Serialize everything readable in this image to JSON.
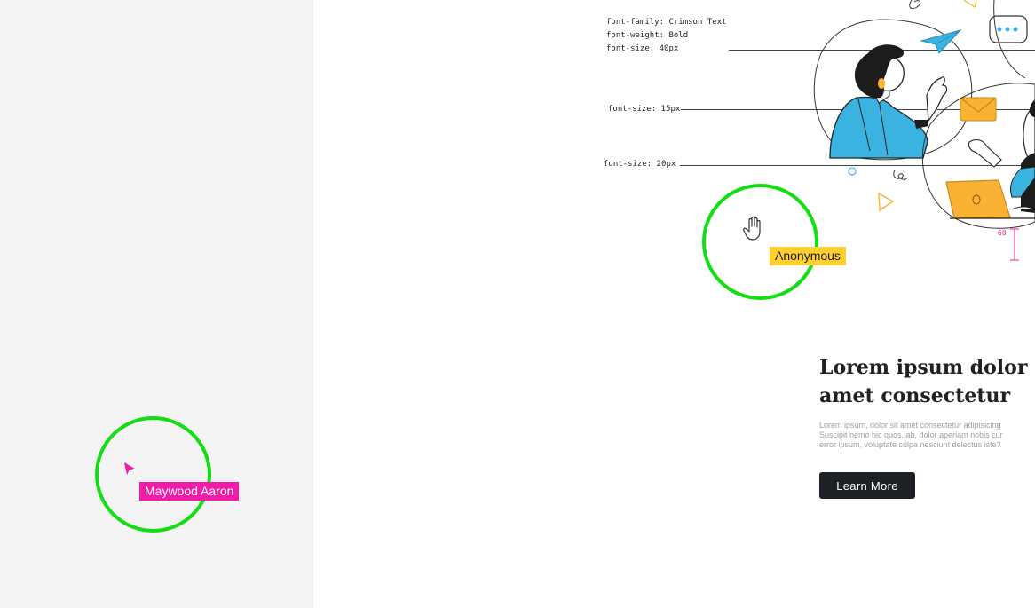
{
  "specs": {
    "font_family": "font-family: Crimson Text",
    "font_weight": "font-weight: Bold",
    "font_size_40": "font-size: 40px",
    "font_size_15": "font-size: 15px",
    "font_size_20": "font-size: 20px"
  },
  "measurement": "60",
  "content": {
    "heading": "Lorem ipsum dolor sit\namet consectetur",
    "body": "Lorem ipsum, dolor sit amet consectetur adipisicing\nSuscipit nemo hic quos, ab, dolor aperiam nobis cur\nerror ipsum, voluptate culpa nesciunt delectus iste?",
    "button": "Learn More"
  },
  "collaborators": [
    {
      "name": "Anonymous",
      "color": "#ffd02e",
      "cursor": "hand-cursor-icon"
    },
    {
      "name": "Maywood Aaron",
      "color": "#f21caa",
      "cursor": "arrow-cursor-icon"
    }
  ],
  "colors": {
    "highlight_ring": "#13dd13",
    "accent_blue": "#3bb3e0",
    "accent_orange": "#f9b234",
    "button_bg": "#1e2227",
    "panel_bg": "#f4f4f4"
  }
}
